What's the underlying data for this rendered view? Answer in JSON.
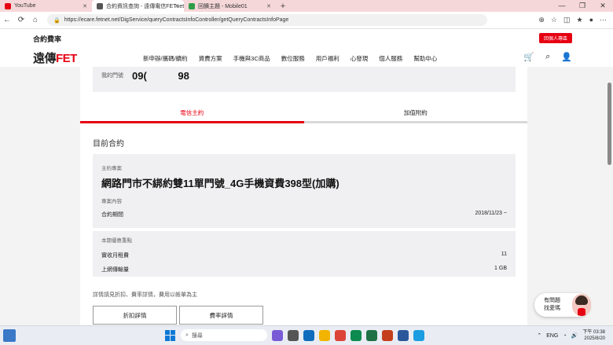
{
  "browser": {
    "tabs": [
      {
        "label": "YouTube",
        "icon": "youtube-icon",
        "color": "#e60012"
      },
      {
        "label": "合約資訊查詢 - 遠傳電信FETnet",
        "icon": "fet-icon",
        "color": "#555555"
      },
      {
        "label": "回饋主題 - Mobile01",
        "icon": "mobile01-icon",
        "color": "#2e9d46"
      }
    ],
    "new_tab": "+",
    "url": "https://ecare.fetnet.net/DigService/queryContractsInfoController/getQueryContractsInfoPage",
    "window_controls": [
      "—",
      "❐",
      "✕"
    ]
  },
  "header": {
    "page_title": "合約費率",
    "login_button": "回個人專區",
    "logo": {
      "part1": "遠傳",
      "part2": "FET"
    },
    "nav": [
      "新申辦/攜碼/續約",
      "資費方案",
      "手機與3C商品",
      "數位服務",
      "用戶福利",
      "心發現",
      "個人服務",
      "幫助中心"
    ]
  },
  "phone": {
    "label": "我的門號",
    "value": "09(  98"
  },
  "tabs": {
    "active": "電信主約",
    "inactive": "加值附約"
  },
  "section_title": "目前合約",
  "plan": {
    "label": "主約專案",
    "name": "網路門市不綁約雙11單門號_4G手機資費398型(加購)",
    "content_label": "專案內容",
    "period_label": "合約期間",
    "period_value": "2018/11/23 ~"
  },
  "promo": {
    "label": "本期優惠重點",
    "rows": [
      {
        "label": "實收月租費",
        "value": "11"
      },
      {
        "label": "上網傳輸量",
        "value": "1 GB"
      }
    ]
  },
  "note": "詳情請見折扣、費率詳情，費用以帳單為主",
  "buttons": {
    "discount": "折扣詳情",
    "rate": "費率詳情"
  },
  "chat": {
    "line1": "有問題",
    "line2": "找愛瑪"
  },
  "taskbar": {
    "search_placeholder": "搜尋",
    "lang": "ENG",
    "time": "下午 03:38",
    "date": "2025/8/20"
  }
}
